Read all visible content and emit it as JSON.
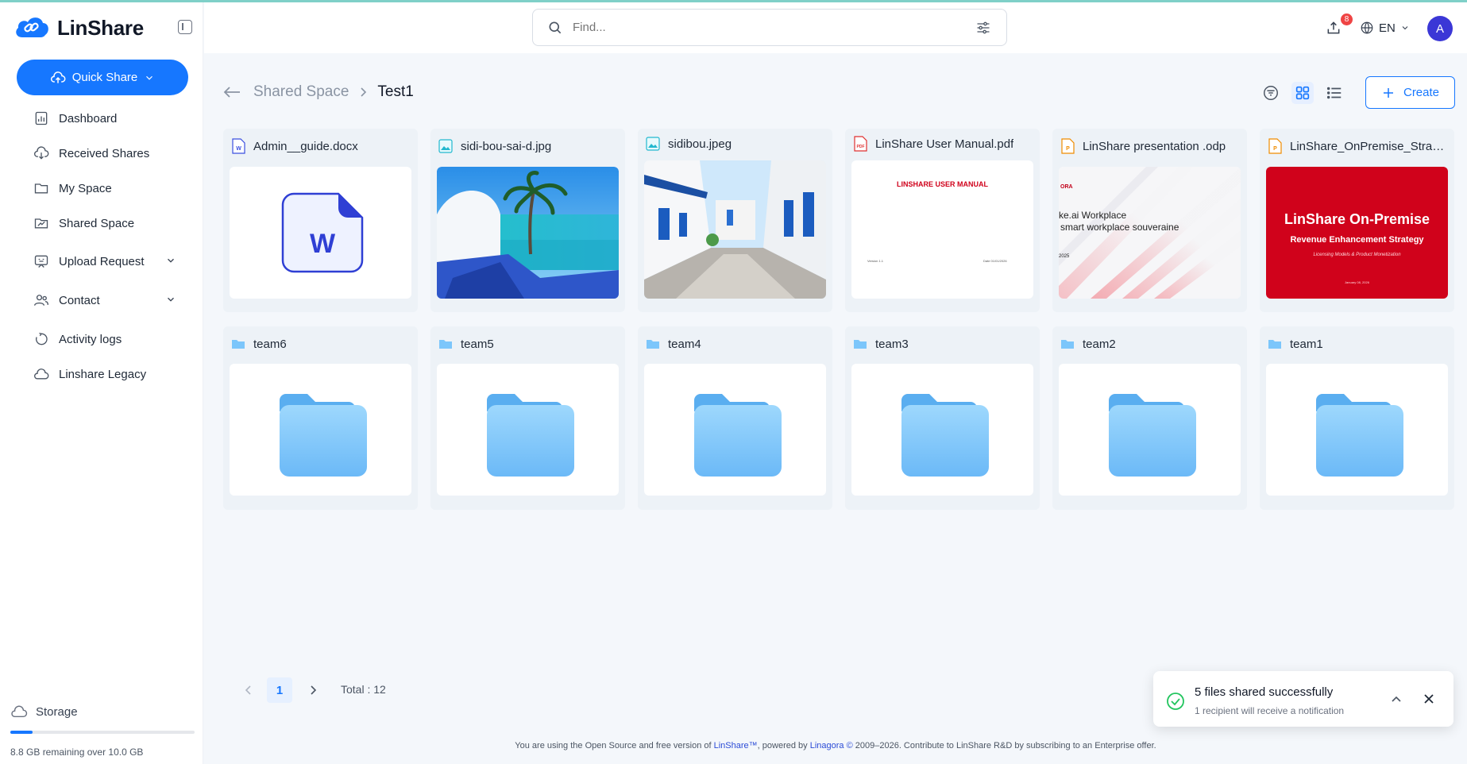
{
  "app": {
    "name": "LinShare",
    "colors": {
      "accent": "#1677ff",
      "folder": "#7cc6fb",
      "success": "#22c55e",
      "danger": "#ef4444"
    }
  },
  "sidebar": {
    "quick_share_label": "Quick Share",
    "items": [
      {
        "label": "Dashboard",
        "icon": "dashboard-icon"
      },
      {
        "label": "Received Shares",
        "icon": "cloud-download-icon"
      },
      {
        "label": "My Space",
        "icon": "folder-icon"
      },
      {
        "label": "Shared Space",
        "icon": "shared-folder-icon"
      },
      {
        "label": "Upload Request",
        "icon": "upload-request-icon",
        "expandable": true
      },
      {
        "label": "Contact",
        "icon": "contacts-icon",
        "expandable": true
      },
      {
        "label": "Activity logs",
        "icon": "history-icon"
      },
      {
        "label": "Linshare Legacy",
        "icon": "cloud-icon"
      }
    ],
    "storage": {
      "label": "Storage",
      "text": "8.8 GB remaining over 10.0 GB",
      "used_fraction": 0.12
    }
  },
  "header": {
    "search_placeholder": "Find...",
    "upload_badge": "8",
    "language": "EN",
    "avatar_initial": "A"
  },
  "toolbar": {
    "breadcrumb_parent": "Shared Space",
    "breadcrumb_current": "Test1",
    "create_label": "Create",
    "view_mode": "grid"
  },
  "files": [
    {
      "name": "Admin__guide.docx",
      "type": "docx",
      "icon": "word-file-icon"
    },
    {
      "name": "sidi-bou-sai-d.jpg",
      "type": "image",
      "icon": "image-file-icon"
    },
    {
      "name": "sidibou.jpeg",
      "type": "image",
      "icon": "image-file-icon"
    },
    {
      "name": "LinShare User Manual.pdf",
      "type": "pdf",
      "icon": "pdf-file-icon",
      "preview": {
        "heading": "LINSHARE USER MANUAL",
        "version": "Version 1.1",
        "date": "Date 01/01/2026"
      }
    },
    {
      "name": "LinShare presentation .odp",
      "type": "odp",
      "icon": "presentation-file-icon",
      "preview": {
        "brand": "ORA",
        "line1": "ke.ai  Workplace",
        "line2": "smart workplace souveraine",
        "year": "2025"
      }
    },
    {
      "name": "LinShare_OnPremise_Strateg...",
      "type": "odp",
      "icon": "presentation-file-icon",
      "preview": {
        "title": "LinShare On-Premise",
        "subtitle": "Revenue Enhancement Strategy",
        "tagline": "Licensing Models & Product Monetization",
        "date": "January 08, 2026"
      }
    }
  ],
  "folders": [
    {
      "name": "team6"
    },
    {
      "name": "team5"
    },
    {
      "name": "team4"
    },
    {
      "name": "team3"
    },
    {
      "name": "team2"
    },
    {
      "name": "team1"
    }
  ],
  "pagination": {
    "current": "1",
    "total_label": "Total : 12"
  },
  "toast": {
    "title": "5 files shared successfully",
    "subtitle": "1 recipient will receive a notification"
  },
  "footer": {
    "prefix": "You are using the Open Source and free version of ",
    "link1": "LinShare™",
    "middle": ", powered by ",
    "link2": "Linagora ©",
    "suffix": " 2009–2026. Contribute to LinShare R&D by subscribing to an Enterprise offer."
  }
}
